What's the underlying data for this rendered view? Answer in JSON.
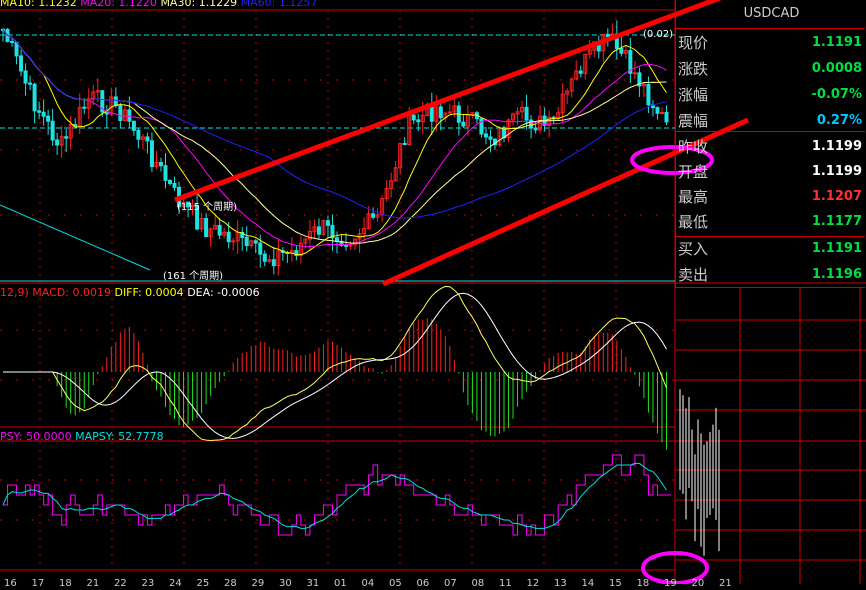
{
  "legend": {
    "ma10": "MA10: 1.1232",
    "ma20": "MA20: 1.1220",
    "ma30": "MA30: 1.1229",
    "ma60": "MA60: 1.1257",
    "macd_params": "12,9)",
    "macd": "MACD: 0.0019",
    "diff": "DIFF: 0.0004",
    "dea": "DEA: -0.0006",
    "psy": "PSY: 50.0000",
    "mapsy": "MAPSY: 52.7778"
  },
  "annotations": {
    "high_note": "(0.02)",
    "period_115": "(115 个周期)",
    "period_161": "(161 个周期)"
  },
  "quote": {
    "symbol": "USDCAD",
    "rows": [
      {
        "label": "现价",
        "value": "1.1191",
        "color": "#00e040"
      },
      {
        "label": "涨跌",
        "value": "0.0008",
        "color": "#00e040"
      },
      {
        "label": "涨幅",
        "value": "-0.07%",
        "color": "#00e040"
      },
      {
        "label": "震幅",
        "value": "0.27%",
        "color": "#00c8ff"
      },
      {
        "label": "昨收",
        "value": "1.1199",
        "color": "#ffffff"
      },
      {
        "label": "开盘",
        "value": "1.1199",
        "color": "#ffffff"
      },
      {
        "label": "最高",
        "value": "1.1207",
        "color": "#ff3030"
      },
      {
        "label": "最低",
        "value": "1.1177",
        "color": "#00e040"
      },
      {
        "label": "买入",
        "value": "1.1191",
        "color": "#00e040"
      },
      {
        "label": "卖出",
        "value": "1.1196",
        "color": "#00e040"
      }
    ]
  },
  "x_axis_labels": [
    "16",
    "17",
    "18",
    "21",
    "22",
    "23",
    "24",
    "25",
    "28",
    "29",
    "30",
    "31",
    "01",
    "04",
    "05",
    "06",
    "07",
    "08",
    "11",
    "12",
    "13",
    "14",
    "15",
    "18",
    "19",
    "20",
    "21"
  ],
  "chart_data": {
    "type": "candlestick",
    "approx_close_path": [
      1.1296,
      1.1221,
      1.1166,
      1.1221,
      1.121,
      1.1166,
      1.1111,
      1.1078,
      1.1067,
      1.1045,
      1.1051,
      1.1078,
      1.1067,
      1.1089,
      1.1188,
      1.121,
      1.1199,
      1.1177,
      1.1199,
      1.1188,
      1.1254,
      1.1287,
      1.1243,
      1.1191
    ],
    "psy_path": [
      60,
      62,
      45,
      50,
      55,
      40,
      35,
      60,
      55,
      50,
      35,
      30,
      40,
      60,
      75,
      75,
      60,
      50,
      40,
      35,
      30,
      45,
      70,
      85,
      80,
      50
    ],
    "colors": {
      "up": "#ff2020",
      "down": "#20e0e0",
      "ma10": "#ffff00",
      "ma20": "#ff00ff",
      "ma30": "#ffffa0",
      "ma60": "#2020ff",
      "trendline": "#ff0000",
      "highlight": "#ff00ff"
    }
  }
}
